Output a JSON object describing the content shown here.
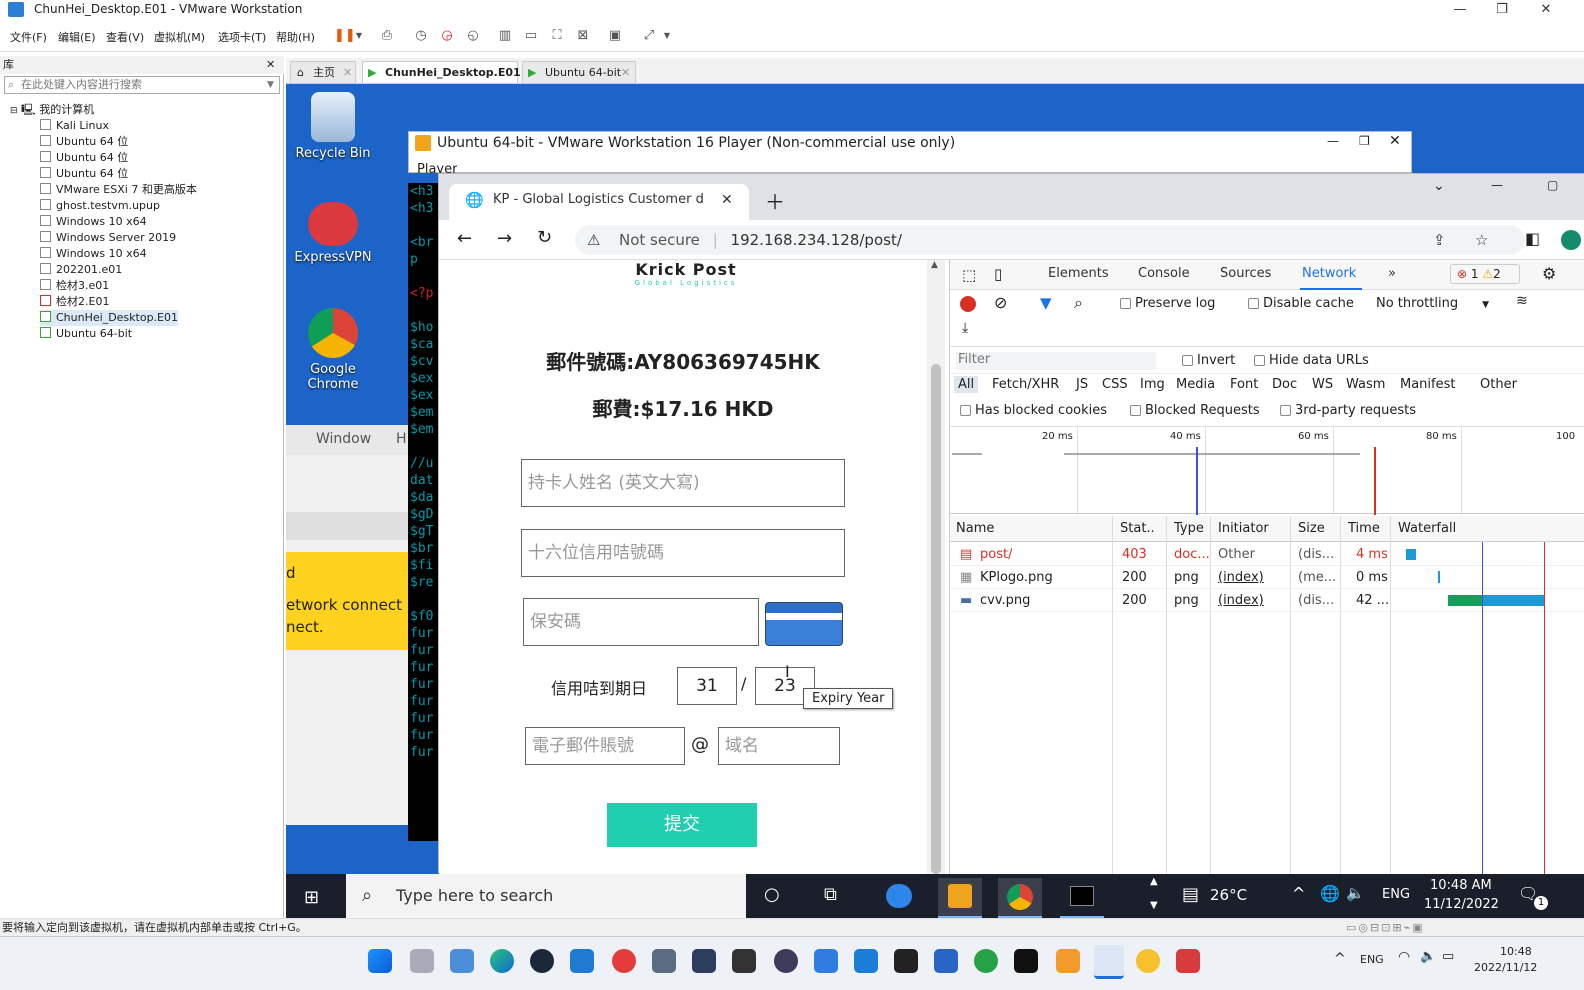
{
  "host": {
    "window_title": "ChunHei_Desktop.E01 - VMware Workstation",
    "menus": [
      "文件(F)",
      "编辑(E)",
      "查看(V)",
      "虚拟机(M)",
      "选项卡(T)",
      "帮助(H)"
    ],
    "library_title": "库",
    "library_search_placeholder": "在此处键入内容进行搜索",
    "tree_root": "我的计算机",
    "tree_items": [
      "Kali Linux",
      "Ubuntu 64 位",
      "Ubuntu 64 位",
      "Ubuntu 64 位",
      "VMware ESXi 7 和更高版本",
      "ghost.testvm.upup",
      "Windows 10 x64",
      "Windows Server 2019",
      "Windows 10 x64",
      "202201.e01",
      "检材3.e01",
      "检材2.E01",
      "ChunHei_Desktop.E01",
      "Ubuntu 64-bit"
    ],
    "vm_tabs": [
      "主页",
      "ChunHei_Desktop.E01",
      "Ubuntu 64-bit"
    ],
    "status_text": "要将输入定向到该虚拟机，请在虚拟机内部单击或按 Ctrl+G。",
    "clock_time": "10:48",
    "clock_date": "2022/11/12",
    "lang": "ENG"
  },
  "guest": {
    "desktop_icons": [
      "Recycle Bin",
      "ExpressVPN",
      "Google Chrome"
    ],
    "behind_window_menu": [
      "Window",
      "H"
    ],
    "yellow_banner": [
      "d",
      "etwork connect",
      "nect."
    ],
    "player_title": "Ubuntu 64-bit - VMware Workstation 16 Player (Non-commercial use only)",
    "player_menu": "Player",
    "terminal_lines": [
      "<h3",
      "<h3",
      "",
      "<br",
      "p",
      "",
      "<?p",
      "",
      "$ho",
      "$ca",
      "$cv",
      "$ex",
      "$ex",
      "$em",
      "$em",
      "",
      "//u",
      "dat",
      "$da",
      "$gD",
      "$gT",
      "$br",
      "$fi",
      "$re",
      "",
      "$f0",
      "fur",
      "fur",
      "fur",
      "fur",
      "fur",
      "fur",
      "fur",
      "fur"
    ],
    "taskbar_search": "Type here to search",
    "weather": "26°C",
    "lang": "ENG",
    "time": "10:48 AM",
    "date": "11/12/2022",
    "notification_count": "1"
  },
  "chrome": {
    "tab_title": "KP - Global Logistics Customer d",
    "security": "Not secure",
    "url": "192.168.234.128/post/"
  },
  "form": {
    "logo_name": "Krick Post",
    "logo_sub": "Global Logistics",
    "tracking": "郵件號碼:AY806369745HK",
    "postage": "郵費:$17.16 HKD",
    "cardholder_placeholder": "持卡人姓名 (英文大寫)",
    "card_number_placeholder": "十六位信用咭號碼",
    "cvv_placeholder": "保安碼",
    "expiry_label": "信用咭到期日",
    "expiry_month": "31",
    "slash": "/",
    "expiry_year": "23",
    "tooltip": "Expiry Year",
    "email_placeholder": "電子郵件賬號",
    "at": "@",
    "domain_placeholder": "域名",
    "submit": "提交"
  },
  "devtools": {
    "tabs": [
      "Elements",
      "Console",
      "Sources",
      "Network"
    ],
    "errors": "1",
    "warnings": "2",
    "preserve_log": "Preserve log",
    "disable_cache": "Disable cache",
    "throttling": "No throttling",
    "filter_placeholder": "Filter",
    "invert": "Invert",
    "hide_data_urls": "Hide data URLs",
    "type_filters": [
      "All",
      "Fetch/XHR",
      "JS",
      "CSS",
      "Img",
      "Media",
      "Font",
      "Doc",
      "WS",
      "Wasm",
      "Manifest",
      "Other"
    ],
    "has_blocked_cookies": "Has blocked cookies",
    "blocked_requests": "Blocked Requests",
    "third_party": "3rd-party requests",
    "timeline_ticks": [
      "20 ms",
      "40 ms",
      "60 ms",
      "80 ms",
      "100"
    ],
    "columns": [
      "Name",
      "Stat..",
      "Type",
      "Initiator",
      "Size",
      "Time",
      "Waterfall"
    ],
    "rows": [
      {
        "name": "post/",
        "status": "403",
        "type": "doc...",
        "initiator": "Other",
        "size": "(dis...",
        "time": "4 ms",
        "error": true
      },
      {
        "name": "KPlogo.png",
        "status": "200",
        "type": "png",
        "initiator": "(index)",
        "size": "(me...",
        "time": "0 ms",
        "error": false
      },
      {
        "name": "cvv.png",
        "status": "200",
        "type": "png",
        "initiator": "(index)",
        "size": "(dis...",
        "time": "42 ...",
        "error": false
      }
    ]
  },
  "colors": {
    "accent_teal": "#1fcfb0",
    "error_red": "#d93025",
    "desktop_blue": "#1c64c8"
  }
}
